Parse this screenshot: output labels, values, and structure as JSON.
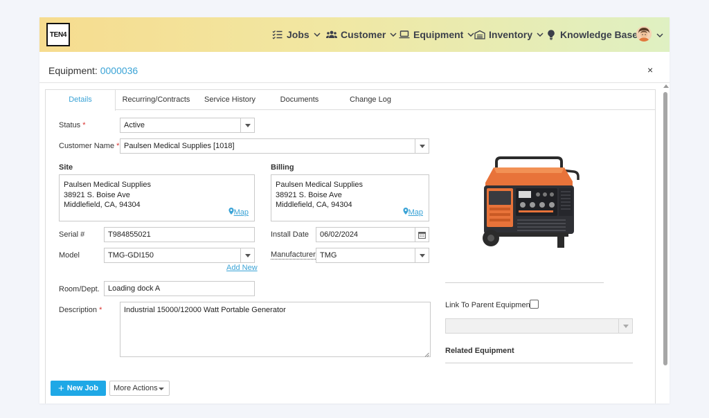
{
  "brand": {
    "logo_text": "TEN4"
  },
  "nav": {
    "items": [
      {
        "label": "Jobs",
        "icon": "checklist-icon"
      },
      {
        "label": "Customer",
        "icon": "users-icon"
      },
      {
        "label": "Equipment",
        "icon": "laptop-icon"
      },
      {
        "label": "Inventory",
        "icon": "warehouse-icon"
      },
      {
        "label": "Knowledge Base",
        "icon": "lightbulb-icon"
      }
    ]
  },
  "header": {
    "prefix": "Equipment: ",
    "equipment_id": "0000036",
    "close": "×"
  },
  "tabs": [
    {
      "label": "Details",
      "active": true
    },
    {
      "label": "Recurring/Contracts",
      "active": false
    },
    {
      "label": "Service History",
      "active": false
    },
    {
      "label": "Documents",
      "active": false
    },
    {
      "label": "Change Log",
      "active": false
    }
  ],
  "form": {
    "status": {
      "label": "Status",
      "required": "*",
      "value": "Active"
    },
    "customer": {
      "label": "Customer Name",
      "required": "*",
      "value": "Paulsen Medical Supplies [1018]"
    },
    "site": {
      "label": "Site",
      "lines": [
        "Paulsen Medical Supplies",
        "38921 S. Boise Ave",
        "Middlefield, CA, 94304"
      ],
      "map_label": "Map"
    },
    "billing": {
      "label": "Billing",
      "lines": [
        "Paulsen Medical Supplies",
        "38921 S. Boise Ave",
        "Middlefield, CA, 94304"
      ],
      "map_label": "Map"
    },
    "serial": {
      "label": "Serial #",
      "value": "T984855021"
    },
    "install_date": {
      "label": "Install Date",
      "value": "06/02/2024"
    },
    "model": {
      "label": "Model",
      "value": "TMG-GDI150",
      "add_new": "Add New"
    },
    "manufacturer": {
      "label": "Manufacturer",
      "value": "TMG"
    },
    "room": {
      "label": "Room/Dept.",
      "value": "Loading dock A"
    },
    "description": {
      "label": "Description",
      "required": "*",
      "value": "Industrial 15000/12000 Watt Portable Generator"
    }
  },
  "side": {
    "link_parent_label": "Link To Parent Equipment",
    "parent_select_value": "",
    "related_label": "Related Equipment"
  },
  "actions": {
    "new_job": "New Job",
    "more_actions": "More Actions"
  },
  "colors": {
    "accent": "#3aa3d6",
    "primary_button": "#1fa8e6",
    "required": "#d9312e"
  }
}
